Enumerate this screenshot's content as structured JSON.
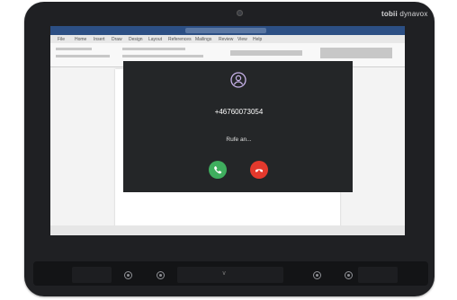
{
  "device": {
    "brand_bold": "tobii",
    "brand_light": "dynavox"
  },
  "call": {
    "number": "+46760073054",
    "status": "Rufe an...",
    "accept_color": "#3fae5e",
    "decline_color": "#e4392d",
    "avatar_icon": "user-circle-icon",
    "accept_icon": "phone-icon",
    "decline_icon": "hang-up-icon"
  },
  "background_app": {
    "menu": [
      "File",
      "Home",
      "Insert",
      "Draw",
      "Design",
      "Layout",
      "References",
      "Mailings",
      "Review",
      "View",
      "Help"
    ]
  },
  "colors": {
    "dialog_bg": "#242628",
    "device_frame": "#1f2023"
  }
}
